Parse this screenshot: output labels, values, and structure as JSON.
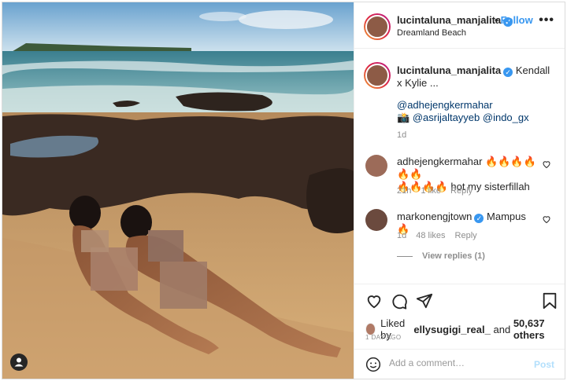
{
  "post": {
    "username": "lucintaluna_manjalita",
    "location": "Dreamland Beach",
    "follow_label": "Follow",
    "separator": "•",
    "more_label": "•••"
  },
  "caption": {
    "username": "lucintaluna_manjalita",
    "text": "Kendall x Kylie ...",
    "mention1": "@adhejengkermahar",
    "camera_emoji": "📸",
    "mention2": "@asrijaltayyeb",
    "mention3": "@indo_gx",
    "time": "1d"
  },
  "comments": [
    {
      "username": "adhejengkermahar",
      "text_line1": "🔥🔥🔥🔥🔥🔥",
      "text_line2": "🔥🔥🔥🔥 hot my sisterfillah",
      "time": "21h",
      "likes": "1 like",
      "reply": "Reply"
    },
    {
      "username": "markonengjtown",
      "text": "Mampus 🔥",
      "time": "1d",
      "likes": "48 likes",
      "reply": "Reply",
      "view_replies": "View replies (1)"
    }
  ],
  "likes": {
    "prefix": "Liked by",
    "user": "ellysugigi_real_",
    "and": "and",
    "count": "50,637 others"
  },
  "time_ago": "1 DAY AGO",
  "add_comment": {
    "placeholder": "Add a comment…",
    "post_label": "Post"
  },
  "icons": {
    "like": "heart-icon",
    "comment": "comment-icon",
    "share": "paper-plane-icon",
    "save": "bookmark-icon",
    "emoji": "smiley-icon",
    "user_tag": "user-tag-icon",
    "verified": "verified-badge-icon"
  },
  "colors": {
    "link_blue": "#3897f0",
    "mention": "#00376b",
    "muted": "#8e8e8e",
    "post_disabled": "#b2dffc"
  }
}
